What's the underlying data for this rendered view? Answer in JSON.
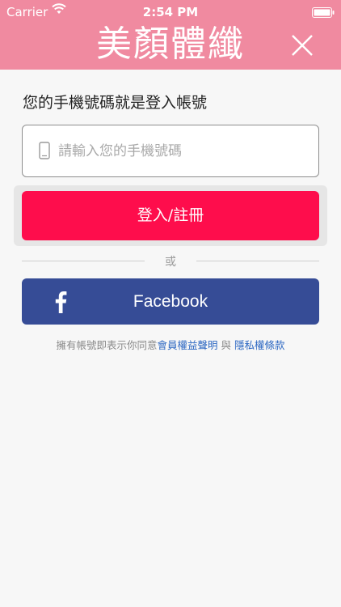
{
  "status_bar": {
    "carrier": "Carrier",
    "time": "2:54 PM"
  },
  "header": {
    "brand": "美顏體纖",
    "close_icon": "close-icon",
    "background_color": "#f08aa0"
  },
  "login": {
    "prompt": "您的手機號碼就是登入帳號",
    "phone_placeholder": "請輸入您的手機號碼",
    "phone_value": "",
    "login_button": "登入/註冊",
    "login_button_color": "#fe0d4c",
    "divider_text": "或",
    "facebook_button": "Facebook",
    "facebook_color": "#364c96"
  },
  "terms": {
    "prefix": "擁有帳號即表示你同意",
    "member_rights": "會員權益聲明",
    "and": " 與 ",
    "privacy": "隱私權條款"
  }
}
